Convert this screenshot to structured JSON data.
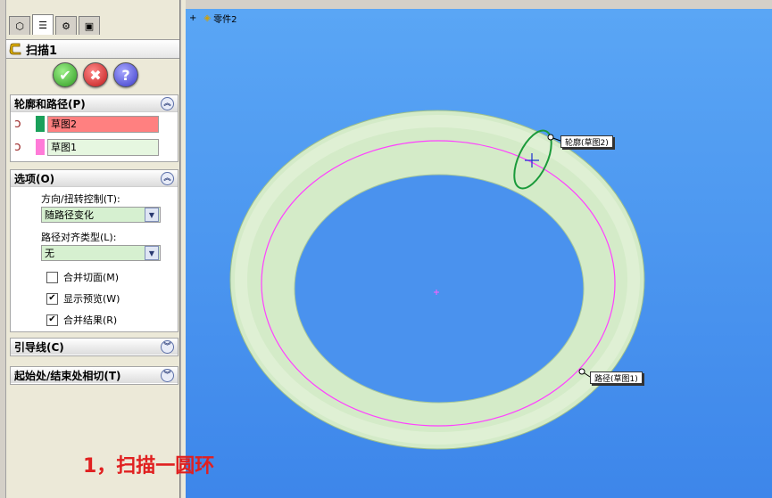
{
  "tabs": [
    {
      "name": "feature-manager-tab",
      "icon": "tree-icon"
    },
    {
      "name": "property-manager-tab",
      "icon": "properties-icon"
    },
    {
      "name": "configuration-manager-tab",
      "icon": "config-icon"
    },
    {
      "name": "display-manager-tab",
      "icon": "display-icon"
    }
  ],
  "property_manager": {
    "title": "扫描1",
    "buttons": {
      "ok": "✔",
      "cancel": "✖",
      "help": "?"
    },
    "profile_path": {
      "header": "轮廓和路径(P)",
      "profile_value": "草图2",
      "profile_color": "#ff8080",
      "path_value": "草图1",
      "path_color": "#e6f7e0"
    },
    "options": {
      "header": "选项(O)",
      "orientation_label": "方向/扭转控制(T):",
      "orientation_value": "随路径变化",
      "path_align_label": "路径对齐类型(L):",
      "path_align_value": "无",
      "merge_tangent_label": "合并切面(M)",
      "merge_tangent_checked": false,
      "show_preview_label": "显示预览(W)",
      "show_preview_checked": true,
      "merge_result_label": "合并结果(R)",
      "merge_result_checked": true
    },
    "guide_curves": {
      "header": "引导线(C)"
    },
    "tangency": {
      "header": "起始处/结束处相切(T)"
    }
  },
  "viewport": {
    "tree_label": "零件2",
    "profile_callout": "轮廓(草图2)",
    "path_callout": "路径(草图1)",
    "background_top": "#5aa6f5",
    "background_bottom": "#3d86ea"
  },
  "caption": "1，扫描一圆环"
}
